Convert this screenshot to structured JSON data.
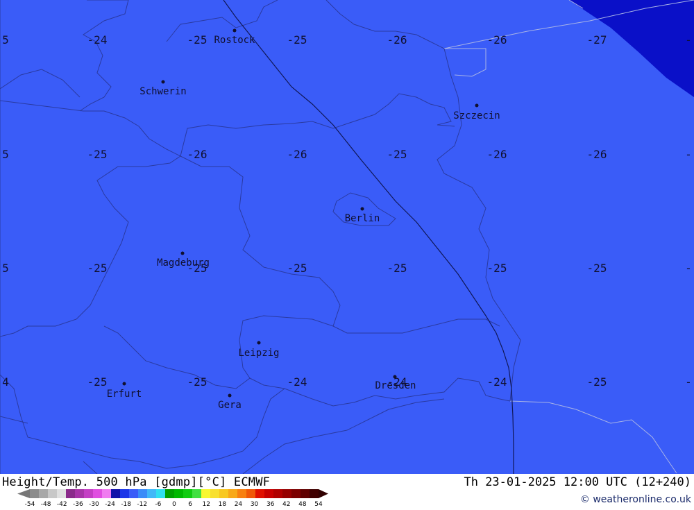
{
  "product_title": "Height/Temp. 500 hPa [gdmp][°C] ECMWF",
  "valid_time": "Th 23-01-2025 12:00 UTC (12+240)",
  "credit": "© weatheronline.co.uk",
  "colors": {
    "land": "#3a5cf8",
    "deep_cold": "#0a10c8",
    "borders": "#2a3aa0",
    "rivers": "#a9b4e6",
    "front": "#101858"
  },
  "cities": [
    {
      "name": "Rostock"
    },
    {
      "name": "Schwerin"
    },
    {
      "name": "Szczecin"
    },
    {
      "name": "Berlin"
    },
    {
      "name": "Magdeburg"
    },
    {
      "name": "Leipzig"
    },
    {
      "name": "Dresden"
    },
    {
      "name": "Erfurt"
    },
    {
      "name": "Gera"
    }
  ],
  "temperature_grid": {
    "rows": [
      [
        "5",
        "-24",
        "-25",
        "-25",
        "-26",
        "-26",
        "-27",
        "-"
      ],
      [
        "5",
        "-25",
        "-26",
        "-26",
        "-25",
        "-26",
        "-26",
        "-"
      ],
      [
        "5",
        "-25",
        "-25",
        "-25",
        "-25",
        "-25",
        "-25",
        "-"
      ],
      [
        "4",
        "-25",
        "-25",
        "-24",
        "-24",
        "-24",
        "-25",
        "-"
      ]
    ]
  },
  "legend": {
    "ticks": [
      "-54",
      "-48",
      "-42",
      "-36",
      "-30",
      "-24",
      "-18",
      "-12",
      "-6",
      "0",
      "6",
      "12",
      "18",
      "24",
      "30",
      "36",
      "42",
      "48",
      "54"
    ],
    "colors": [
      "#8c8c8c",
      "#a8a8a8",
      "#c8c8c8",
      "#e0e0e0",
      "#8a2a8a",
      "#a833a8",
      "#c43ec4",
      "#e04ee0",
      "#f07cf0",
      "#1010a8",
      "#1c36e8",
      "#3a5cf8",
      "#3a8cf8",
      "#40b8f8",
      "#30e0f0",
      "#00a000",
      "#00b800",
      "#10cc10",
      "#40e040",
      "#f8f830",
      "#f8e030",
      "#f8c820",
      "#f8a818",
      "#f88010",
      "#f05808",
      "#e01000",
      "#c80000",
      "#b00000",
      "#960000",
      "#7c0000",
      "#600000",
      "#400000"
    ]
  }
}
